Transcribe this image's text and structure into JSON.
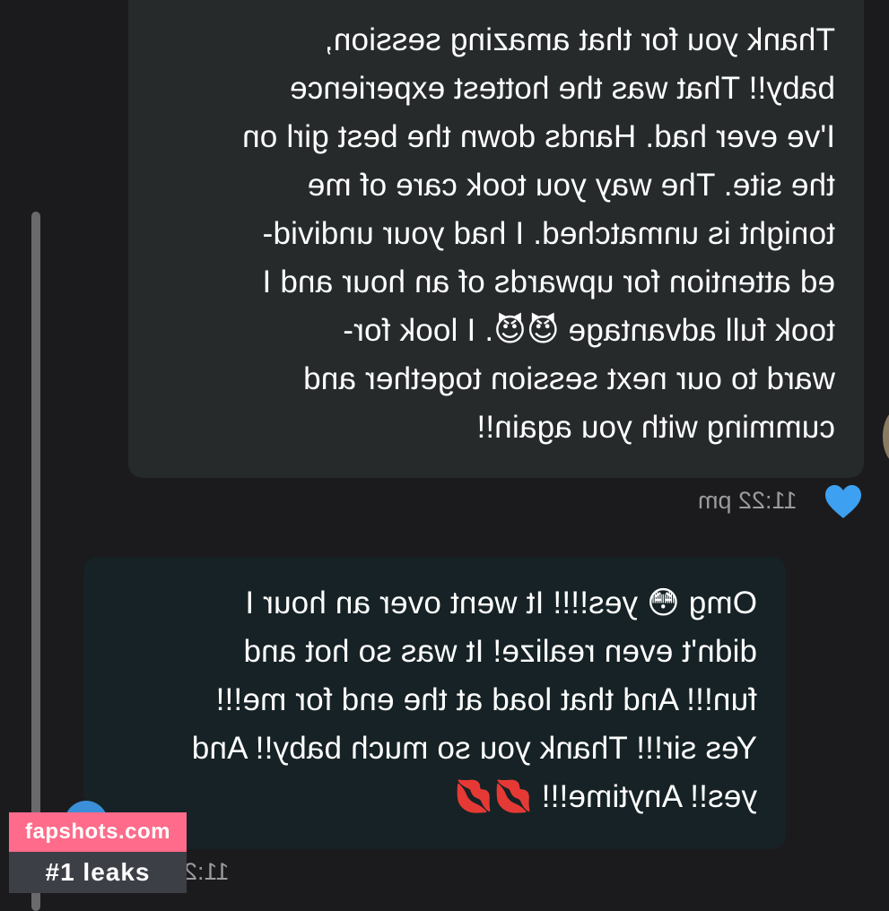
{
  "messages": [
    {
      "text": "Thank you for that amazing session,\nbaby!! That was the hottest experience\nI've ever had. Hands down the best girl on\nthe site. The way you took care of me\ntonight is unmatched. I had your undivid-\ned attention for upwards of an hour and I\ntook full advantage 😈😈. I look for-\nward to our next session together and\ncumming with you again!!",
      "time": "11:22 pm",
      "liked": true
    },
    {
      "text": "Omg 😳 yes!!!! It went over an hour I\ndidn't even realize! It was so hot and\nfun!!! And that load at the end for me!!!\nYes sir!!! Thank you so much baby!! And\nyes!! Anytime!!! 💋💋",
      "time": "11:2"
    }
  ],
  "watermark": {
    "site": "fapshots.com",
    "tag": "#1 leaks"
  },
  "colors": {
    "background": "#1b1b1d",
    "bubble_outgoing": "#262a2b",
    "bubble_incoming": "#162225",
    "heart": "#3ea0f0",
    "watermark_pink": "#ff6b8a"
  }
}
